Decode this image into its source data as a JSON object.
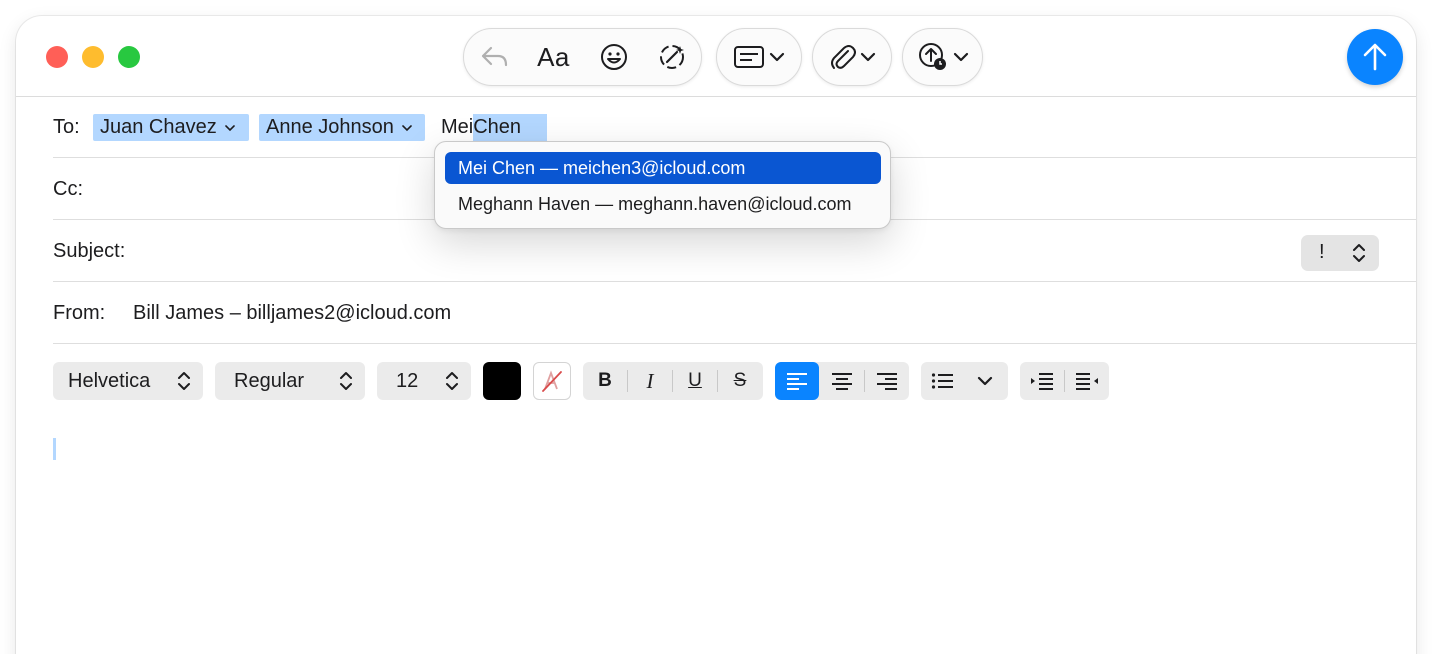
{
  "window": {
    "traffic_lights": [
      "close",
      "minimize",
      "zoom"
    ]
  },
  "toolbar": {
    "format_text_label": "Aa",
    "icons": [
      "reply-icon",
      "emoji-icon",
      "writing-tools-icon",
      "header-fields-icon",
      "attachment-icon",
      "upload-icon"
    ]
  },
  "compose": {
    "to": {
      "label": "To:",
      "recipients": [
        {
          "name": "Juan Chavez"
        },
        {
          "name": "Anne Johnson"
        }
      ],
      "typed_prefix": "Mei",
      "typed_completion": " Chen"
    },
    "cc": {
      "label": "Cc:",
      "value": ""
    },
    "subject": {
      "label": "Subject:",
      "value": "",
      "priority_symbol": "!"
    },
    "from": {
      "label": "From:",
      "value": "Bill James – billjames2@icloud.com"
    }
  },
  "autocomplete": {
    "items": [
      {
        "label": "Mei Chen — meichen3@icloud.com",
        "selected": true
      },
      {
        "label": "Meghann Haven — meghann.haven@icloud.com",
        "selected": false
      }
    ]
  },
  "format_bar": {
    "font": "Helvetica",
    "style": "Regular",
    "size": "12",
    "text_color": "#000000",
    "alignment": "left"
  },
  "colors": {
    "accent": "#0a84ff",
    "selection": "#b3d7ff",
    "menu_highlight": "#0a56d2"
  }
}
